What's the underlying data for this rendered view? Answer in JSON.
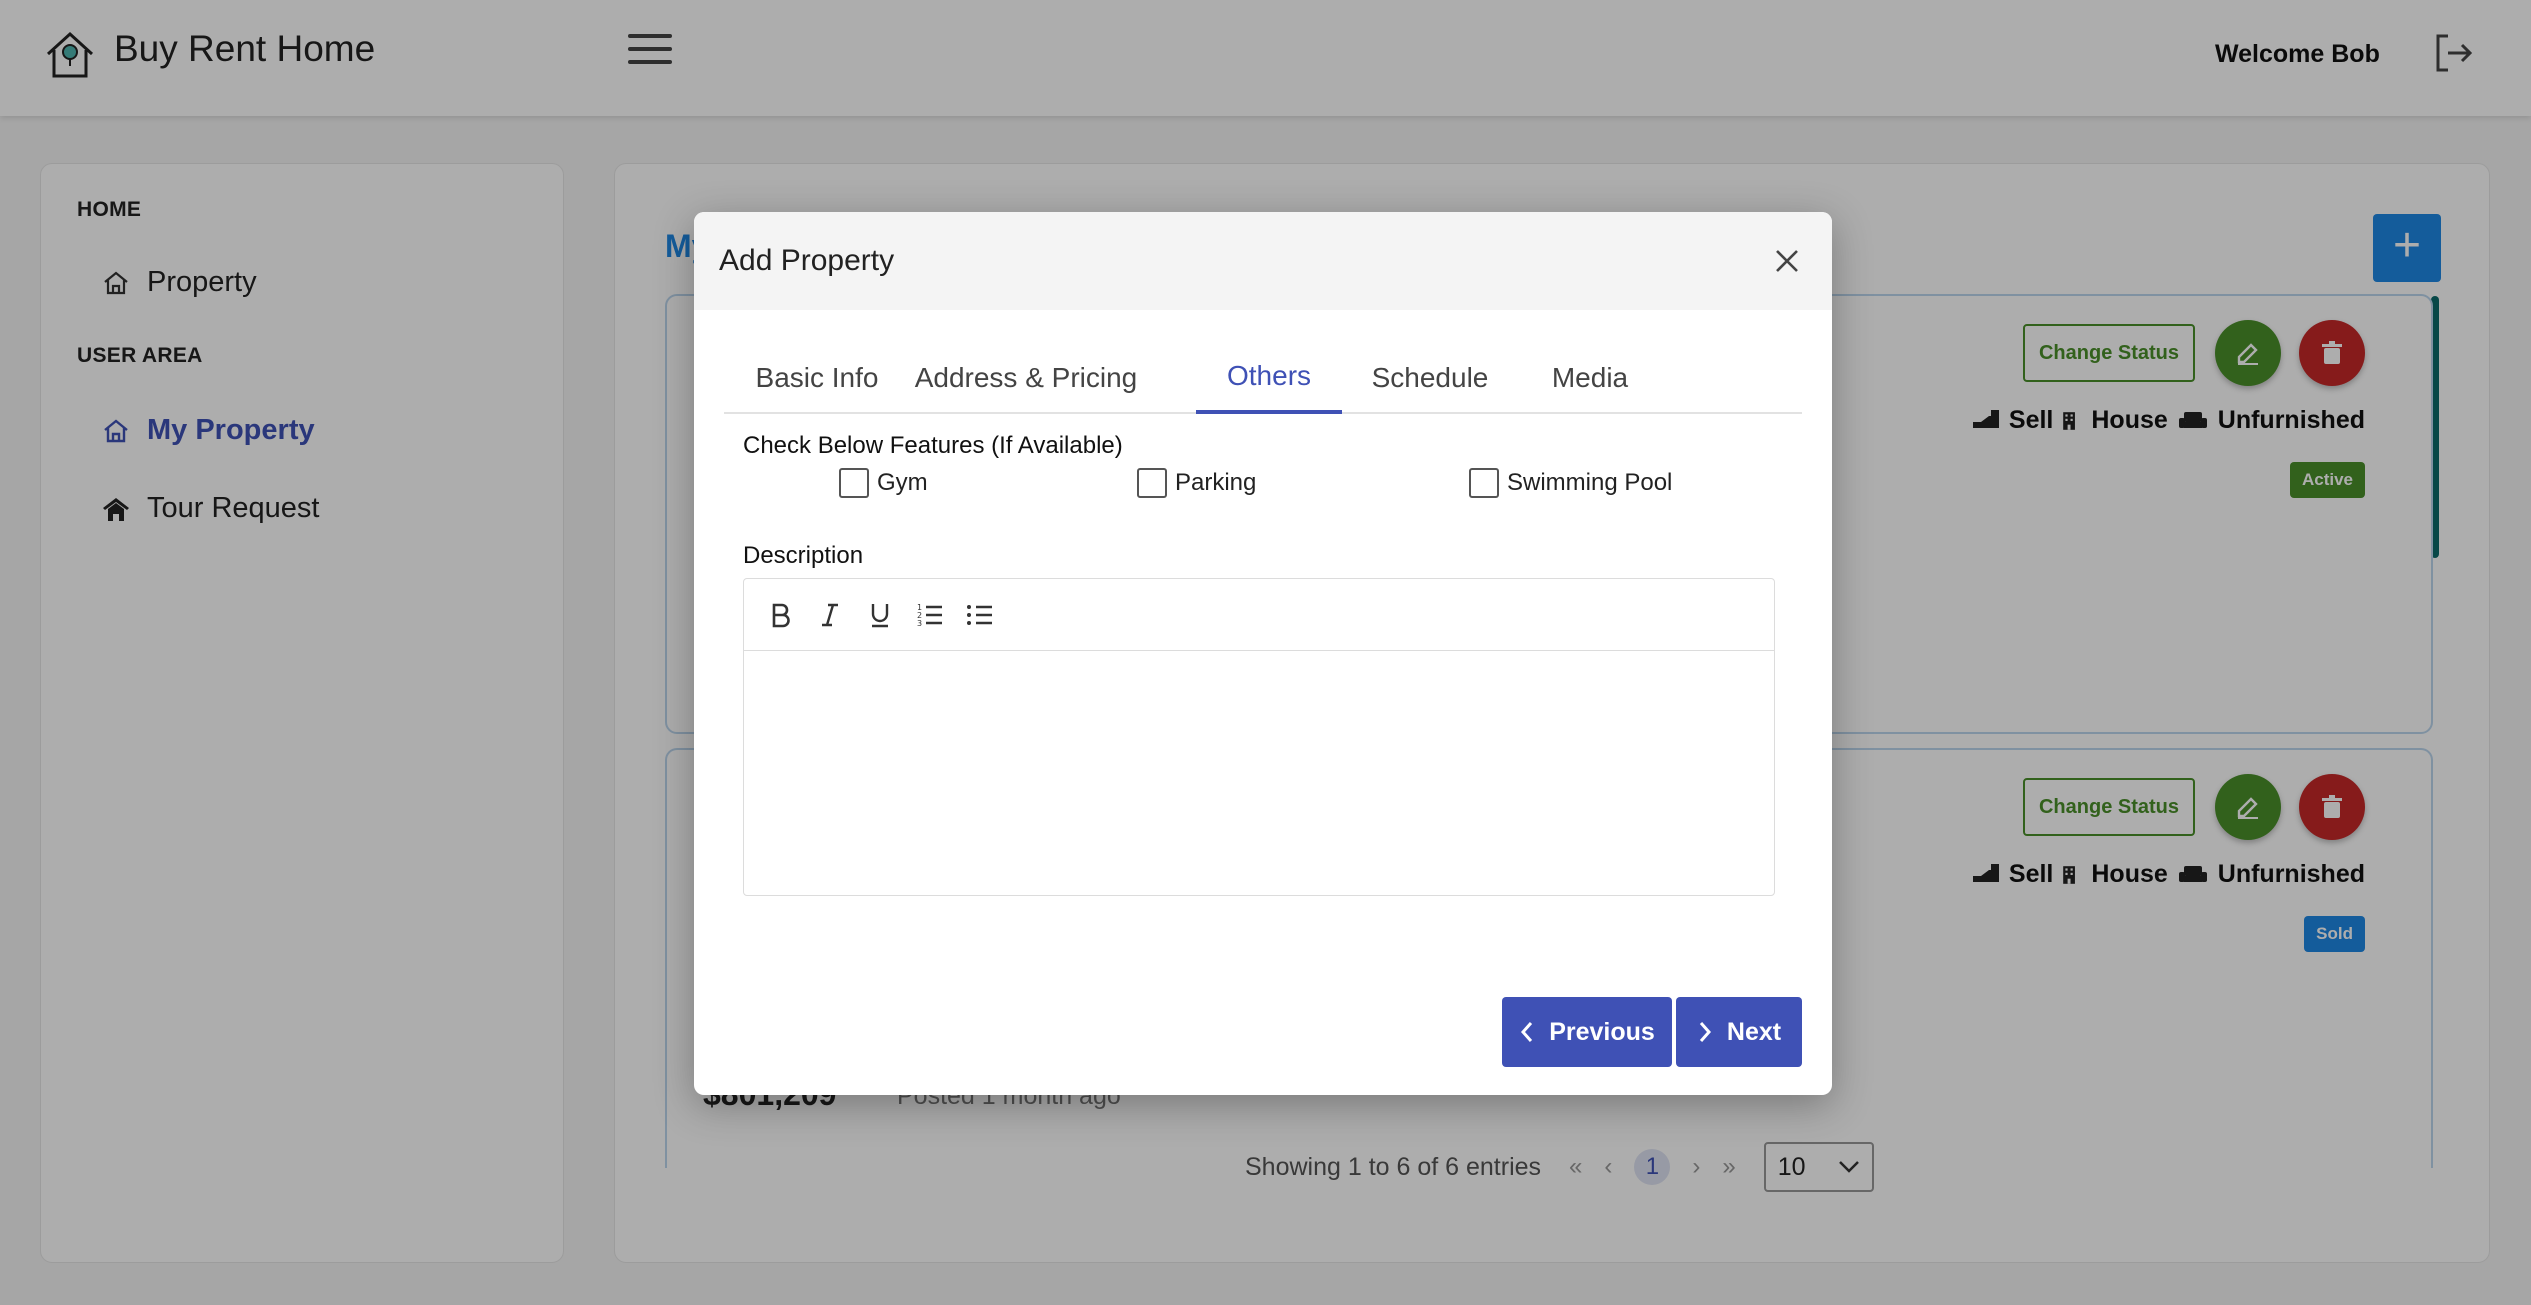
{
  "header": {
    "app_title": "Buy Rent Home",
    "welcome_text": "Welcome Bob"
  },
  "sidebar": {
    "sections": [
      {
        "title": "HOME",
        "items": [
          {
            "label": "Property",
            "icon": "home-icon"
          }
        ]
      },
      {
        "title": "USER AREA",
        "items": [
          {
            "label": "My Property",
            "icon": "home-icon",
            "active": true
          },
          {
            "label": "Tour Request",
            "icon": "tour-icon"
          }
        ]
      }
    ]
  },
  "main": {
    "title": "My",
    "add_label": "+",
    "cards": [
      {
        "change_status_label": "Change Status",
        "listing_type": "Sell",
        "property_type": "House",
        "furnishing": "Unfurnished",
        "status": "Active",
        "status_color": "#4a8f2a"
      },
      {
        "change_status_label": "Change Status",
        "listing_type": "Sell",
        "property_type": "House",
        "furnishing": "Unfurnished",
        "status": "Sold",
        "status_color": "#1e88e5",
        "price": "$801,209",
        "posted": "Posted 1 month ago"
      }
    ],
    "pagination": {
      "summary": "Showing 1 to 6 of 6 entries",
      "current_page": "1",
      "page_size": "10"
    }
  },
  "modal": {
    "title": "Add Property",
    "tabs": [
      "Basic Info",
      "Address & Pricing",
      "Others",
      "Schedule",
      "Media"
    ],
    "active_tab": "Others",
    "features_label": "Check Below Features (If Available)",
    "features": [
      "Gym",
      "Parking",
      "Swimming Pool"
    ],
    "description_label": "Description",
    "description_value": "",
    "previous_label": "Previous",
    "next_label": "Next"
  },
  "colors": {
    "primary": "#3f51b5",
    "accent_blue": "#1e88e5",
    "active_green": "#4a8f2a",
    "delete_red": "#c62828"
  }
}
